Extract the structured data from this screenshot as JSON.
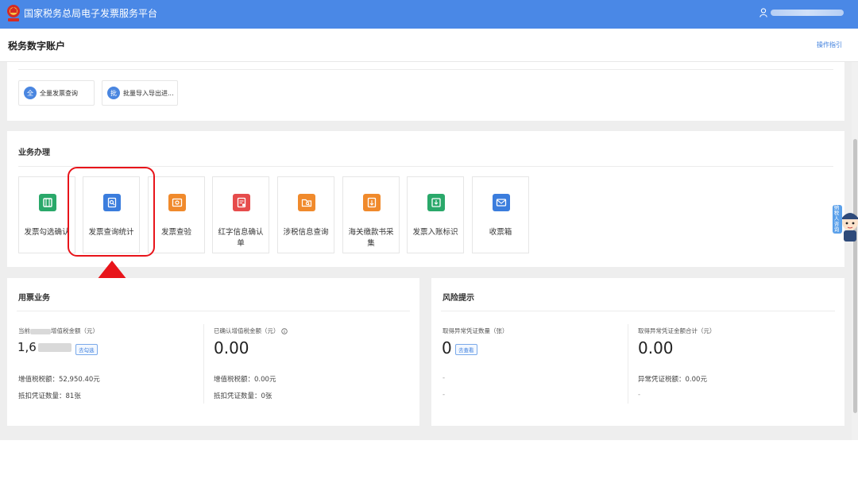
{
  "topbar": {
    "app_title": "国家税务总局电子发票服务平台",
    "emblem_icon": "tax-emblem-icon",
    "user_icon": "user-icon",
    "bg_color": "#4a88e6"
  },
  "page": {
    "title": "税务数字账户",
    "guide_link": "操作指引"
  },
  "quick": {
    "buttons": [
      {
        "badge": "全",
        "label": "全量发票查询"
      },
      {
        "badge": "批",
        "label": "批量导入导出进..."
      }
    ]
  },
  "business": {
    "title": "业务办理",
    "tiles": [
      {
        "label": "发票勾选确认",
        "icon": "ticket-icon",
        "color": "#2aa86a"
      },
      {
        "label": "发票查询统计",
        "icon": "search-doc-icon",
        "color": "#3b7ddd"
      },
      {
        "label": "发票查验",
        "icon": "inspect-ticket-icon",
        "color": "#f08a2c"
      },
      {
        "label": "红字信息确认单",
        "icon": "red-doc-icon",
        "color": "#e64c4c"
      },
      {
        "label": "涉税信息查询",
        "icon": "folder-search-icon",
        "color": "#f08a2c"
      },
      {
        "label": "海关缴款书采集",
        "icon": "customs-doc-icon",
        "color": "#f08a2c"
      },
      {
        "label": "发票入账标识",
        "icon": "inbox-icon",
        "color": "#2aa86a"
      },
      {
        "label": "收票箱",
        "icon": "mail-icon",
        "color": "#3b7ddd"
      }
    ]
  },
  "usage": {
    "title": "用票业务",
    "left": {
      "label_prefix": "当前",
      "label_suffix": "增值税金额（元）",
      "amount_prefix": "1,6",
      "tag": "去勾选",
      "line1_label": "增值税税额：",
      "line1_value": "52,950.40元",
      "line2_label": "抵扣凭证数量：",
      "line2_value": "81张"
    },
    "right": {
      "label": "已确认增值税金额（元）",
      "info_icon": "info-circle-icon",
      "amount": "0.00",
      "line1_label": "增值税税额：",
      "line1_value": "0.00元",
      "line2_label": "抵扣凭证数量：",
      "line2_value": "0张"
    }
  },
  "risk": {
    "title": "风险提示",
    "left": {
      "label": "取得异常凭证数量（张）",
      "amount": "0",
      "tag": "去查看",
      "line1": "-",
      "line2": "-"
    },
    "right": {
      "label": "取得异常凭证金额合计（元）",
      "amount": "0.00",
      "line1_label": "异常凭证税额：",
      "line1_value": "0.00元",
      "line2": "-"
    }
  },
  "mascot": {
    "icon": "mascot-icon",
    "text": "纳税人咨询"
  }
}
